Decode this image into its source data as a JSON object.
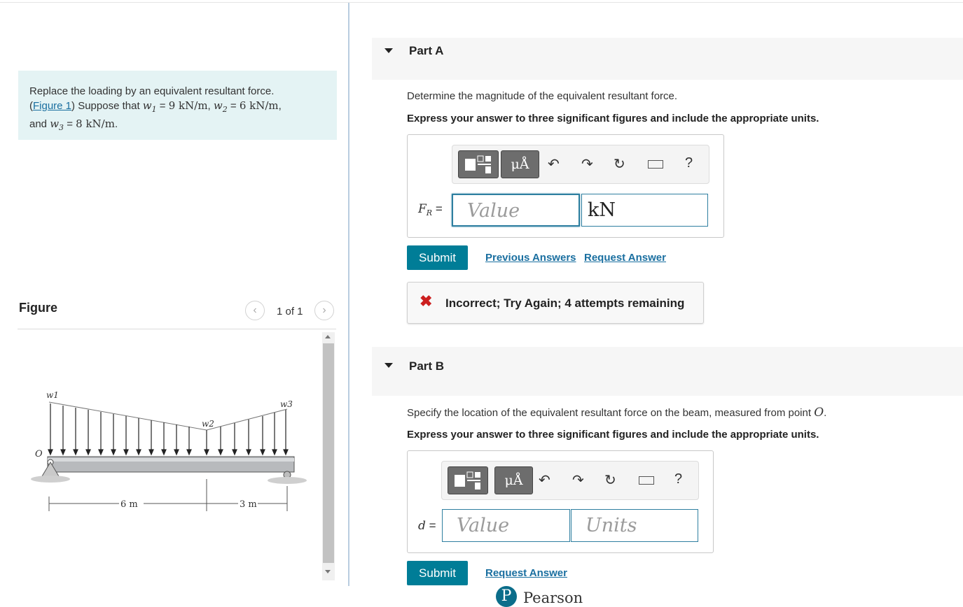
{
  "problem": {
    "intro": "Replace the loading by an equivalent resultant force.",
    "figure_link": "Figure 1",
    "suppose": "Suppose that",
    "w1": "w1",
    "w1_value": "9 kN/m",
    "w2": "w2",
    "w2_value": "6 kN/m",
    "and": "and",
    "w3": "w3",
    "w3_value": "8 kN/m"
  },
  "figure": {
    "title": "Figure",
    "pager": "1 of 1",
    "labels": {
      "w1": "w1",
      "w2": "w2",
      "w3": "w3",
      "origin": "O",
      "span1": "6 m",
      "span2": "3 m"
    }
  },
  "partA": {
    "title": "Part A",
    "question": "Determine the magnitude of the equivalent resultant force.",
    "instruction": "Express your answer to three significant figures and include the appropriate units.",
    "var_label": "FR =",
    "value_placeholder": "Value",
    "units_value": "kN",
    "submit": "Submit",
    "previous_answers": "Previous Answers",
    "request_answer": "Request Answer",
    "feedback": "Incorrect; Try Again; 4 attempts remaining"
  },
  "partB": {
    "title": "Part B",
    "question": "Specify the location of the equivalent resultant force on the beam, measured from point",
    "point": "O",
    "instruction": "Express your answer to three significant figures and include the appropriate units.",
    "var_label": "d =",
    "value_placeholder": "Value",
    "units_placeholder": "Units",
    "submit": "Submit",
    "request_answer": "Request Answer"
  },
  "toolbar": {
    "units_symbol": "μÅ",
    "help": "?"
  },
  "footer": {
    "brand": "Pearson",
    "logo_letter": "P"
  }
}
